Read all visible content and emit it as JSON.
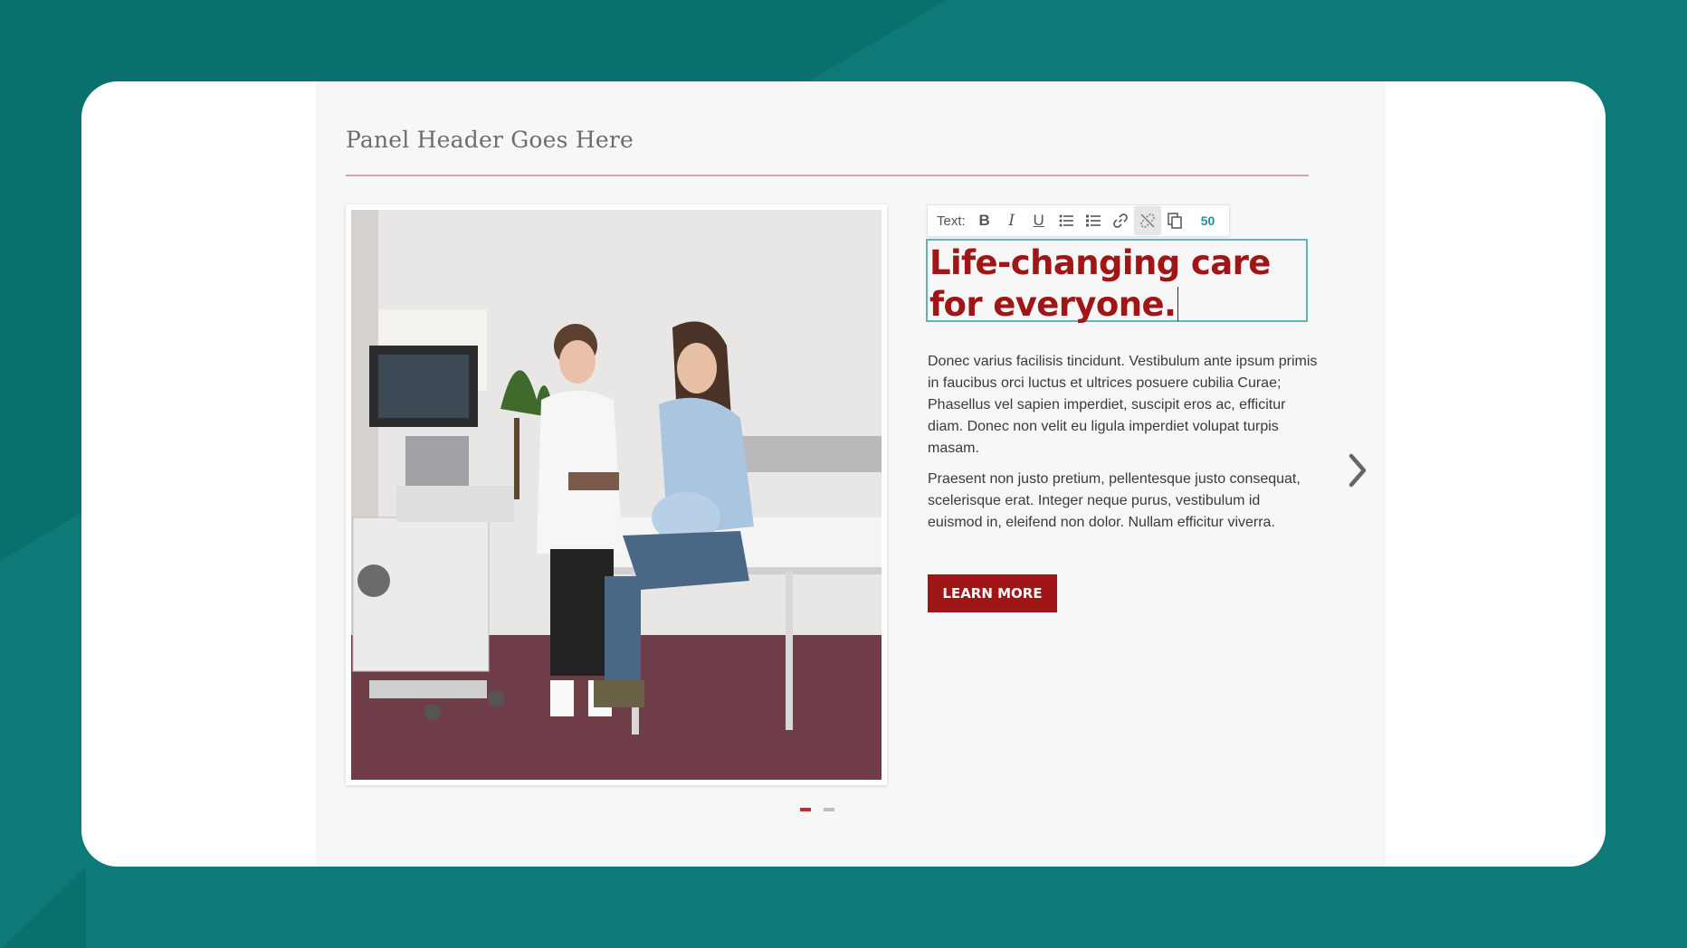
{
  "panel": {
    "header": "Panel Header Goes Here"
  },
  "toolbar": {
    "label": "Text:",
    "bold_label": "B",
    "italic_label": "I",
    "underline_label": "U",
    "char_count": "50"
  },
  "slide": {
    "headline": "Life-changing care for everyone.",
    "paragraph1": "Donec varius facilisis tincidunt. Vestibulum ante ipsum primis in faucibus orci luctus et ultrices posuere cubilia Curae; Phasellus vel sapien imperdiet, suscipit eros ac, efficitur diam. Donec non velit eu ligula imperdiet volupat turpis masam.",
    "paragraph2": "Praesent non justo pretium, pellentesque justo consequat, scelerisque erat. Integer neque purus, vestibulum id euismod in, eleifend non dolor. Nullam efficitur viverra.",
    "cta_label": "LEARN MORE"
  },
  "carousel": {
    "current_slide": 1,
    "total_slides": 2
  },
  "colors": {
    "background": "#0d7a78",
    "accent_red": "#a01515",
    "focus_outline": "#5fb7b5"
  }
}
